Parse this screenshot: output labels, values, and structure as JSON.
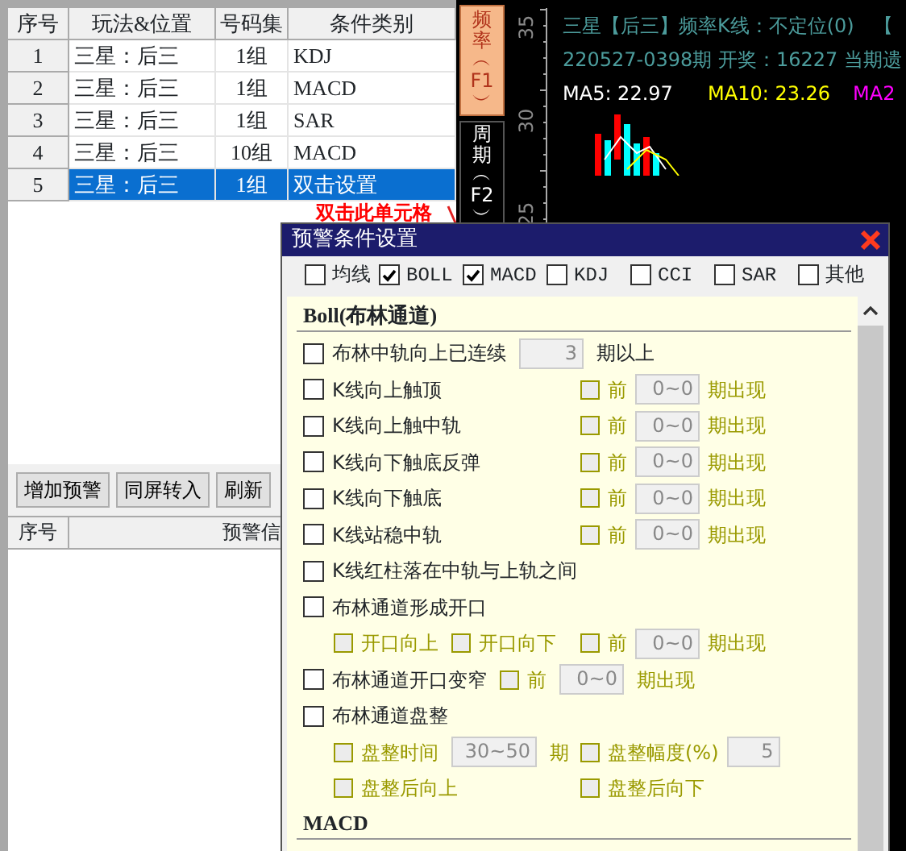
{
  "left_panel": {
    "table": {
      "columns": [
        "序号",
        "玩法&位置",
        "号码集",
        "条件类别"
      ],
      "rows": [
        {
          "cells": [
            "1",
            "三星：后三",
            "1组",
            "KDJ"
          ],
          "selected": false
        },
        {
          "cells": [
            "2",
            "三星：后三",
            "1组",
            "MACD"
          ],
          "selected": false
        },
        {
          "cells": [
            "3",
            "三星：后三",
            "1组",
            "SAR"
          ],
          "selected": false
        },
        {
          "cells": [
            "4",
            "三星：后三",
            "10组",
            "MACD"
          ],
          "selected": false
        },
        {
          "cells": [
            "5",
            "三星：后三",
            "1组",
            "双击设置"
          ],
          "selected": true
        }
      ]
    },
    "buttons": [
      "增加预警",
      "同屏转入",
      "刷新"
    ],
    "list_table": {
      "columns": [
        "序号",
        "预警信"
      ]
    }
  },
  "chart": {
    "tabs": [
      {
        "label": "频率︵F1︶",
        "selected": true
      },
      {
        "label": "周期︵F2︶",
        "selected": false
      }
    ],
    "y_axis_labels": [
      "35",
      "30",
      "25"
    ],
    "title": "三星【后三】频率K线：不定位(0)　【",
    "info": "220527-0398期 开奖：16227 当期遗",
    "moving_averages": [
      {
        "label": "MA5: 22.97",
        "color": "#ffffff"
      },
      {
        "label": "MA10: 23.26",
        "color": "#ffff00"
      },
      {
        "label": "MA2",
        "color": "#ff00ff"
      }
    ]
  },
  "annotation": "双击此单元格",
  "dialog": {
    "title": "预警条件设置",
    "indicators": [
      {
        "label": "均线",
        "checked": false
      },
      {
        "label": "BOLL",
        "checked": true
      },
      {
        "label": "MACD",
        "checked": true
      },
      {
        "label": "KDJ",
        "checked": false
      },
      {
        "label": "CCI",
        "checked": false
      },
      {
        "label": "SAR",
        "checked": false
      },
      {
        "label": "其他",
        "checked": false
      }
    ],
    "sections": [
      {
        "title": "Boll(布林通道)",
        "rows": [
          {
            "sub": false,
            "main": [
              {
                "kind": "check",
                "label": "布林中轨向上已连续",
                "checked": false,
                "disabled": false
              },
              {
                "kind": "field",
                "value": "3"
              },
              {
                "kind": "text",
                "text": "期以上",
                "disabled": false
              }
            ]
          },
          {
            "sub": false,
            "main": [
              {
                "kind": "check",
                "label": "K线向上触顶",
                "checked": false,
                "disabled": false
              }
            ],
            "tail": [
              {
                "kind": "check",
                "label": "前",
                "checked": false,
                "disabled": true
              },
              {
                "kind": "field",
                "value": "0~0"
              },
              {
                "kind": "text",
                "text": "期出现",
                "disabled": true
              }
            ]
          },
          {
            "sub": false,
            "main": [
              {
                "kind": "check",
                "label": "K线向上触中轨",
                "checked": false,
                "disabled": false
              }
            ],
            "tail": [
              {
                "kind": "check",
                "label": "前",
                "checked": false,
                "disabled": true
              },
              {
                "kind": "field",
                "value": "0~0"
              },
              {
                "kind": "text",
                "text": "期出现",
                "disabled": true
              }
            ]
          },
          {
            "sub": false,
            "main": [
              {
                "kind": "check",
                "label": "K线向下触底反弹",
                "checked": false,
                "disabled": false
              }
            ],
            "tail": [
              {
                "kind": "check",
                "label": "前",
                "checked": false,
                "disabled": true
              },
              {
                "kind": "field",
                "value": "0~0"
              },
              {
                "kind": "text",
                "text": "期出现",
                "disabled": true
              }
            ]
          },
          {
            "sub": false,
            "main": [
              {
                "kind": "check",
                "label": "K线向下触底",
                "checked": false,
                "disabled": false
              }
            ],
            "tail": [
              {
                "kind": "check",
                "label": "前",
                "checked": false,
                "disabled": true
              },
              {
                "kind": "field",
                "value": "0~0"
              },
              {
                "kind": "text",
                "text": "期出现",
                "disabled": true
              }
            ]
          },
          {
            "sub": false,
            "main": [
              {
                "kind": "check",
                "label": "K线站稳中轨",
                "checked": false,
                "disabled": false
              }
            ],
            "tail": [
              {
                "kind": "check",
                "label": "前",
                "checked": false,
                "disabled": true
              },
              {
                "kind": "field",
                "value": "0~0"
              },
              {
                "kind": "text",
                "text": "期出现",
                "disabled": true
              }
            ]
          },
          {
            "sub": false,
            "main": [
              {
                "kind": "check",
                "label": "K线红柱落在中轨与上轨之间",
                "checked": false,
                "disabled": false
              }
            ]
          },
          {
            "sub": false,
            "main": [
              {
                "kind": "check",
                "label": "布林通道形成开口",
                "checked": false,
                "disabled": false
              }
            ]
          },
          {
            "sub": true,
            "main": [
              {
                "kind": "check",
                "label": "开口向上",
                "checked": false,
                "disabled": true
              },
              {
                "kind": "check",
                "label": "开口向下",
                "checked": false,
                "disabled": true
              }
            ],
            "tail": [
              {
                "kind": "check",
                "label": "前",
                "checked": false,
                "disabled": true
              },
              {
                "kind": "field",
                "value": "0~0"
              },
              {
                "kind": "text",
                "text": "期出现",
                "disabled": true
              }
            ]
          },
          {
            "sub": false,
            "main": [
              {
                "kind": "check",
                "label": "布林通道开口变窄",
                "checked": false,
                "disabled": false
              },
              {
                "kind": "check",
                "label": "前",
                "checked": false,
                "disabled": true
              },
              {
                "kind": "field",
                "value": "0~0"
              },
              {
                "kind": "text",
                "text": "期出现",
                "disabled": true
              }
            ]
          },
          {
            "sub": false,
            "main": [
              {
                "kind": "check",
                "label": "布林通道盘整",
                "checked": false,
                "disabled": false
              }
            ]
          },
          {
            "sub": true,
            "main": [
              {
                "kind": "check",
                "label": "盘整时间",
                "checked": false,
                "disabled": true
              },
              {
                "kind": "field",
                "value": "30~50"
              },
              {
                "kind": "text",
                "text": "期",
                "disabled": true
              }
            ],
            "tail": [
              {
                "kind": "check",
                "label": "盘整幅度(%)",
                "checked": false,
                "disabled": true
              },
              {
                "kind": "field",
                "value": "5"
              }
            ]
          },
          {
            "sub": true,
            "main": [
              {
                "kind": "check",
                "label": "盘整后向上",
                "checked": false,
                "disabled": true
              }
            ],
            "tail": [
              {
                "kind": "check",
                "label": "盘整后向下",
                "checked": false,
                "disabled": true
              }
            ]
          }
        ]
      },
      {
        "title": "MACD"
      }
    ]
  }
}
